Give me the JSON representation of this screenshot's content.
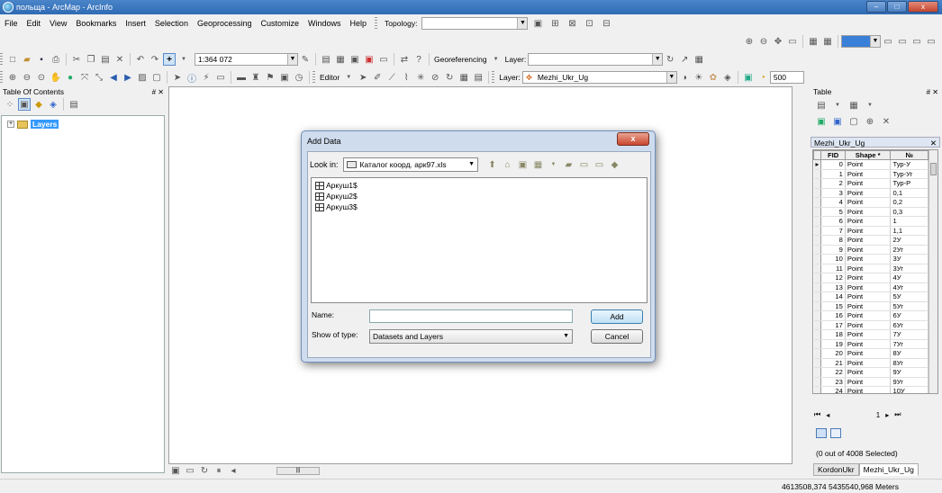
{
  "window": {
    "title": "польща - ArcMap - ArcInfo",
    "controls": {
      "minimize": "–",
      "maximize": "□",
      "close": "x"
    }
  },
  "menu": {
    "items": [
      "File",
      "Edit",
      "View",
      "Bookmarks",
      "Insert",
      "Selection",
      "Geoprocessing",
      "Customize",
      "Windows",
      "Help"
    ],
    "topology_label": "Topology:"
  },
  "toolbar": {
    "scale": "1:364 072",
    "georeferencing_label": "Georeferencing",
    "layer_label": "Layer:",
    "editor_label": "Editor",
    "layer2_label": "Layer:",
    "layer2_value": "Mezhi_Ukr_Ug",
    "zoom_value": "500"
  },
  "toc": {
    "title": "Table Of Contents",
    "controls": "# ✕",
    "layers_label": "Layers"
  },
  "table_panel": {
    "title": "Table",
    "controls": "# ✕",
    "layer_title": "Mezhi_Ukr_Ug",
    "close": "✕",
    "columns": [
      "FID",
      "Shape *",
      "№"
    ],
    "rows": [
      [
        "0",
        "Point",
        "Тур-У"
      ],
      [
        "1",
        "Point",
        "Тур-Уг"
      ],
      [
        "2",
        "Point",
        "Тур-Р"
      ],
      [
        "3",
        "Point",
        "0,1"
      ],
      [
        "4",
        "Point",
        "0,2"
      ],
      [
        "5",
        "Point",
        "0,3"
      ],
      [
        "6",
        "Point",
        "1"
      ],
      [
        "7",
        "Point",
        "1,1"
      ],
      [
        "8",
        "Point",
        "2У"
      ],
      [
        "9",
        "Point",
        "2Уг"
      ],
      [
        "10",
        "Point",
        "3У"
      ],
      [
        "11",
        "Point",
        "3Уг"
      ],
      [
        "12",
        "Point",
        "4У"
      ],
      [
        "13",
        "Point",
        "4Уг"
      ],
      [
        "14",
        "Point",
        "5У"
      ],
      [
        "15",
        "Point",
        "5Уг"
      ],
      [
        "16",
        "Point",
        "6У"
      ],
      [
        "17",
        "Point",
        "6Уг"
      ],
      [
        "18",
        "Point",
        "7У"
      ],
      [
        "19",
        "Point",
        "7Уг"
      ],
      [
        "20",
        "Point",
        "8У"
      ],
      [
        "21",
        "Point",
        "8Уг"
      ],
      [
        "22",
        "Point",
        "9У"
      ],
      [
        "23",
        "Point",
        "9Уг"
      ],
      [
        "24",
        "Point",
        "10У"
      ]
    ],
    "page": "1",
    "selected_text": "(0 out of 4008 Selected)",
    "tabs": [
      "KordonUkr",
      "Mezhi_Ukr_Ug"
    ]
  },
  "dialog": {
    "title": "Add Data",
    "close": "x",
    "look_in_label": "Look in:",
    "look_in_value": "Каталог коорд. арк97.xls",
    "files": [
      "Аркуш1$",
      "Аркуш2$",
      "Аркуш3$"
    ],
    "name_label": "Name:",
    "name_value": "",
    "show_type_label": "Show of type:",
    "show_type_value": "Datasets and Layers",
    "add_label": "Add",
    "cancel_label": "Cancel"
  },
  "status": {
    "coords": "4613508,374  5435540,968 Meters"
  }
}
